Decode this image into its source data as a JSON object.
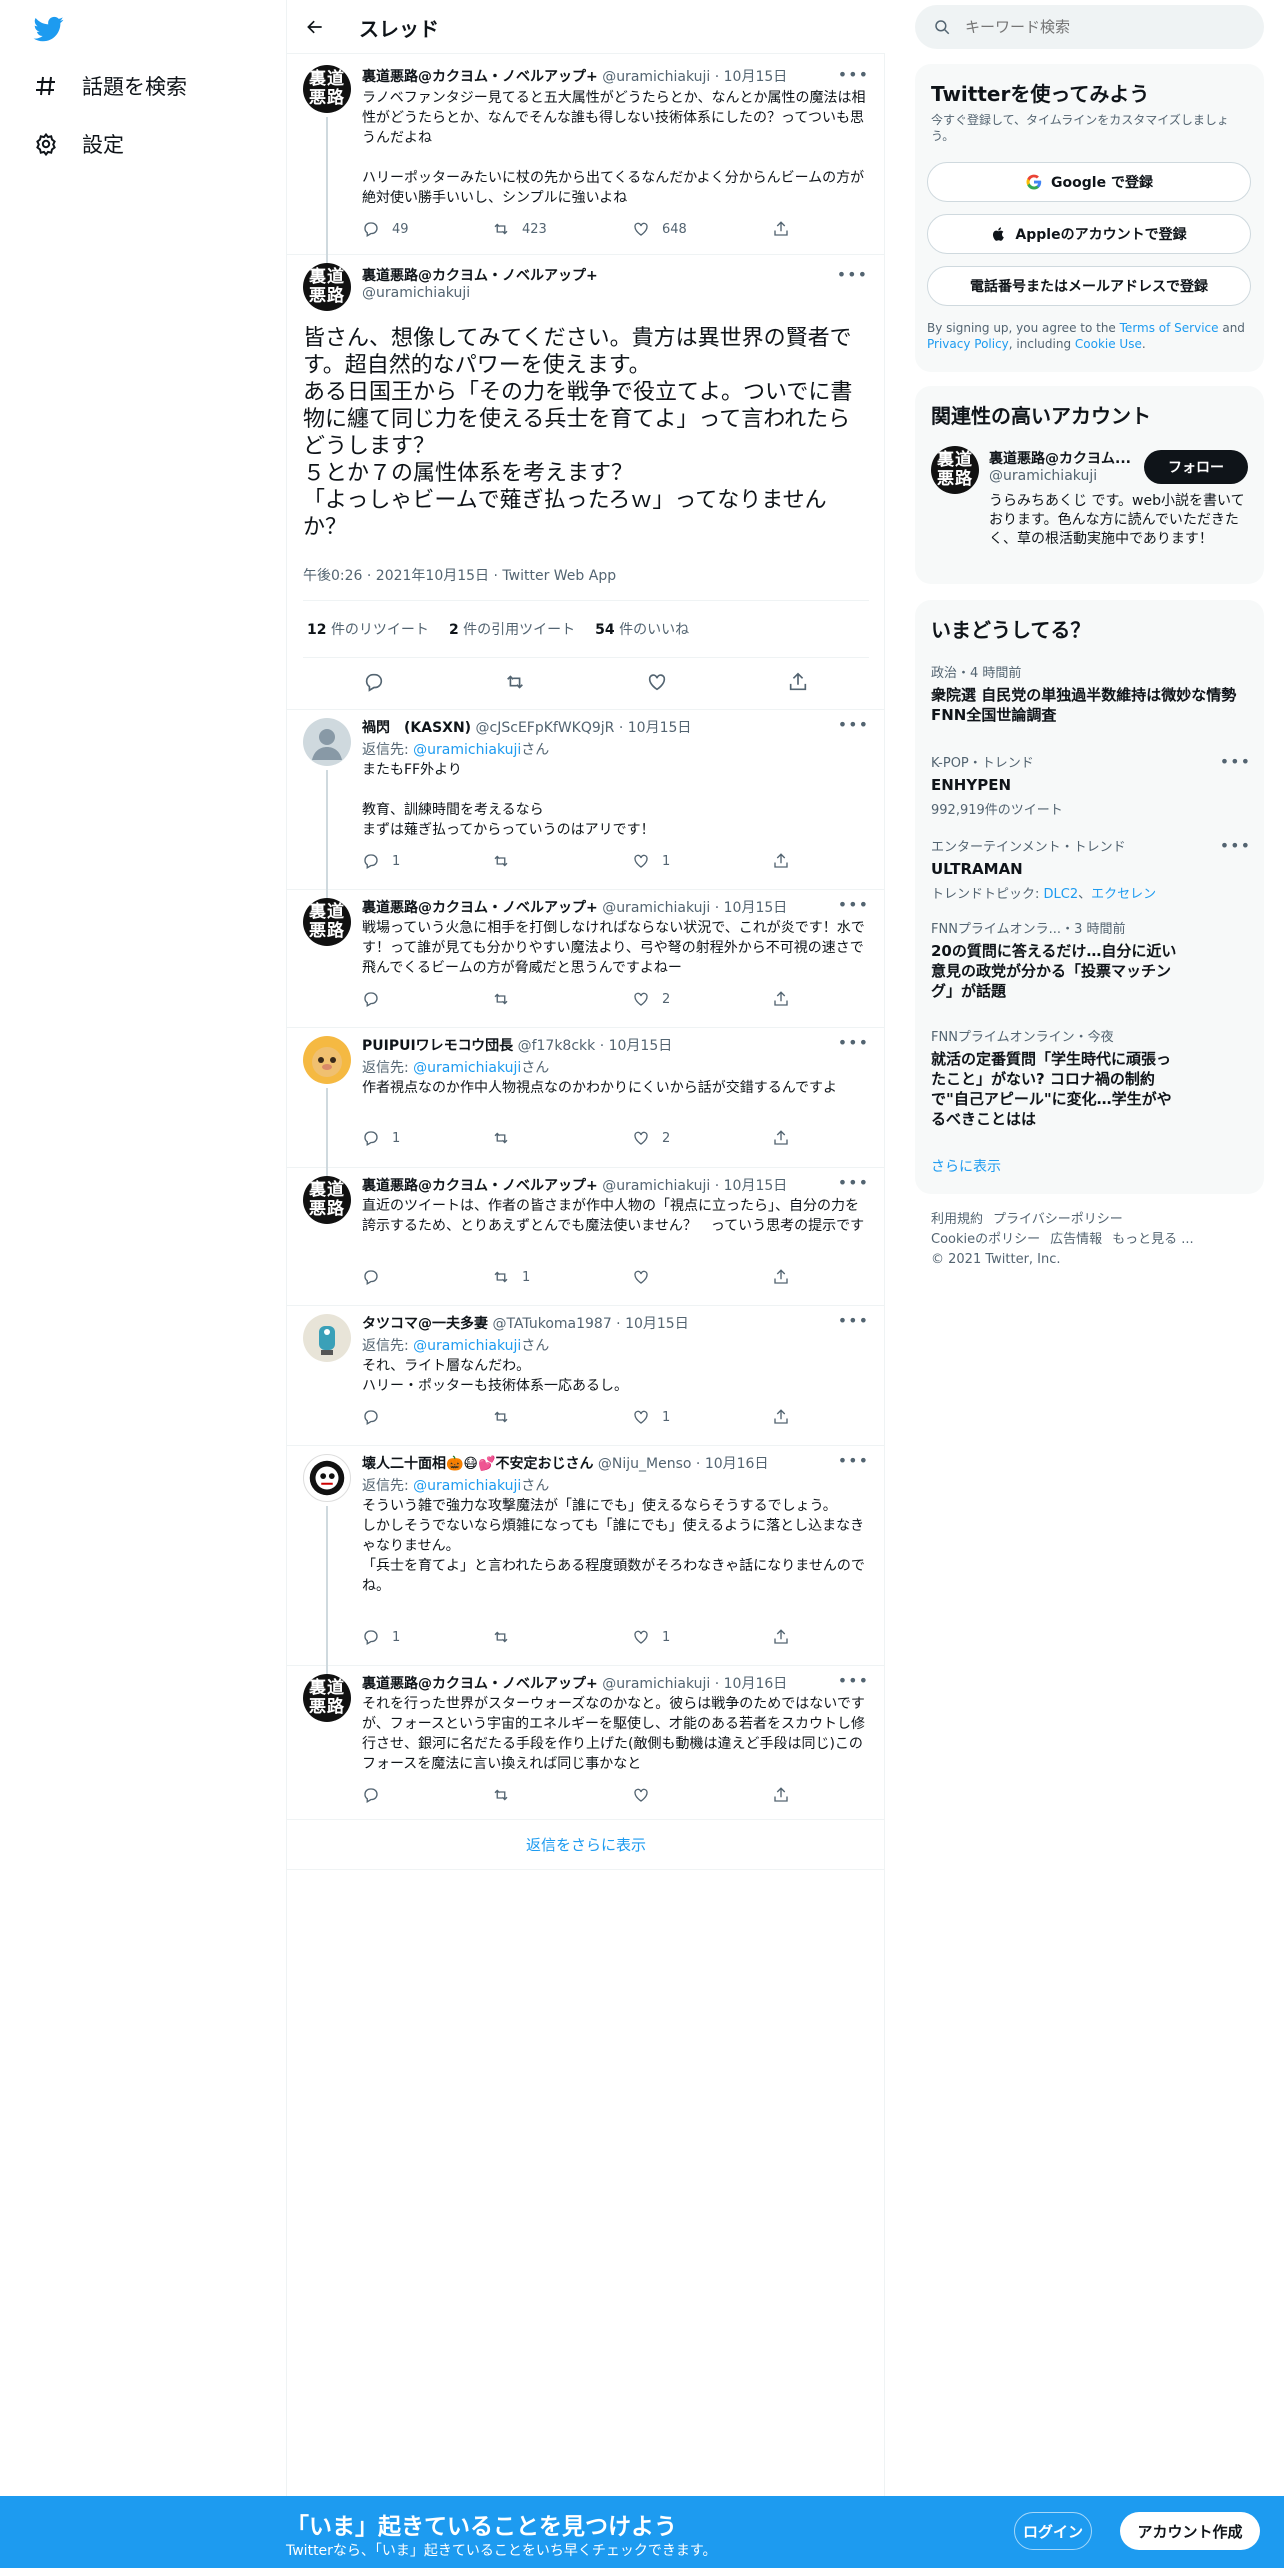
{
  "nav": {
    "explore": "話題を検索",
    "settings": "設定"
  },
  "header": {
    "title": "スレッド"
  },
  "tweets": {
    "t0": {
      "name": "裏道悪路@カクヨム・ノベルアップ+",
      "meta": "@uramichiakuji · 10月15日",
      "body": "ラノベファンタジー見てると五大属性がどうたらとか、なんとか属性の魔法は相性がどうたらとか、なんでそんな誰も得しない技術体系にしたの？ってついも思うんだよね\n\nハリーポッターみたいに杖の先から出てくるなんだかよく分からんビームの方が絶対使い勝手いいし、シンプルに強いよね",
      "replies": "49",
      "retweets": "423",
      "likes": "648"
    },
    "main": {
      "name": "裏道悪路@カクヨム・ノベルアップ+",
      "handle": "@uramichiakuji",
      "body": "皆さん、想像してみてください。貴方は異世界の賢者です。超自然的なパワーを使えます。\nある日国王から「その力を戦争で役立てよ。ついでに書物に纏て同じ力を使える兵士を育てよ」って言われたらどうします？\n５とか７の属性体系を考えます？\n「よっしゃビームで薙ぎ払ったろｗ」ってなりませんか？",
      "meta": "午後0:26 · 2021年10月15日 · Twitter Web App",
      "retweets_n": "12",
      "retweets_l": "件のリツイート",
      "quotes_n": "2",
      "quotes_l": "件の引用ツイート",
      "likes_n": "54",
      "likes_l": "件のいいね"
    },
    "r1": {
      "name": "禍閃　(KASXN)",
      "meta": "@cJScEFpKfWKQ9jR · 10月15日",
      "reply_to": "返信先: ",
      "reply_handle": "@uramichiakuji",
      "reply_suffix": "さん",
      "body": "またもFF外より\n\n教育、訓練時間を考えるなら\nまずは薙ぎ払ってからっていうのはアリです！",
      "replies": "1",
      "retweets": "",
      "likes": "1"
    },
    "r2": {
      "name": "裏道悪路@カクヨム・ノベルアップ+",
      "meta": "@uramichiakuji · 10月15日",
      "body": "戦場っていう火急に相手を打倒しなければならない状況で、これが炎です！水です！って誰が見ても分かりやすい魔法より、弓や弩の射程外から不可視の速さで飛んでくるビームの方が脅威だと思うんですよねー",
      "replies": "",
      "retweets": "",
      "likes": "2"
    },
    "r3": {
      "name": "PUIPUIワレモコウ団長",
      "meta": "@f17k8ckk · 10月15日",
      "reply_to": "返信先: ",
      "reply_handle": "@uramichiakuji",
      "reply_suffix": "さん",
      "body": "作者視点なのか作中人物視点なのかわかりにくいから話が交錯するんですよ",
      "replies": "1",
      "retweets": "",
      "likes": "2"
    },
    "r4": {
      "name": "裏道悪路@カクヨム・ノベルアップ+",
      "meta": "@uramichiakuji · 10月15日",
      "body": "直近のツイートは、作者の皆さまが作中人物の「視点に立ったら」、自分の力を誇示するため、とりあえずとんでも魔法使いません？　っていう思考の提示です",
      "replies": "",
      "retweets": "1",
      "likes": ""
    },
    "r5": {
      "name": "タツコマ@一夫多妻",
      "meta": "@TATukoma1987 · 10月15日",
      "reply_to": "返信先: ",
      "reply_handle": "@uramichiakuji",
      "reply_suffix": "さん",
      "body": "それ、ライト層なんだわ。\nハリー・ポッターも技術体系一応あるし。",
      "replies": "",
      "retweets": "",
      "likes": "1"
    },
    "r6": {
      "name": "壊人二十面相🎃😷💕不安定おじさん",
      "meta": "@Niju_Menso · 10月16日",
      "reply_to": "返信先: ",
      "reply_handle": "@uramichiakuji",
      "reply_suffix": "さん",
      "body": "そういう雑で強力な攻撃魔法が「誰にでも」使えるならそうするでしょう。\nしかしそうでないなら煩雑になっても「誰にでも」使えるように落とし込まなきゃなりません。\n「兵士を育てよ」と言われたらある程度頭数がそろわなきゃ話になりませんのでね。",
      "replies": "1",
      "retweets": "",
      "likes": "1"
    },
    "r7": {
      "name": "裏道悪路@カクヨム・ノベルアップ+",
      "meta": "@uramichiakuji · 10月16日",
      "body": "それを行った世界がスターウォーズなのかなと。彼らは戦争のためではないですが、フォースという宇宙的エネルギーを駆使し、才能のある若者をスカウトし修行させ、銀河に名だたる手段を作り上げた(敵側も動機は違えど手段は同じ)このフォースを魔法に言い換えれば同じ事かなと",
      "replies": "",
      "retweets": "",
      "likes": ""
    }
  },
  "show_more": "返信をさらに表示",
  "avatar_text": {
    "line1": "裏道",
    "line2": "悪路"
  },
  "search": {
    "placeholder": "キーワード検索"
  },
  "signup_card": {
    "title": "Twitterを使ってみよう",
    "subtitle": "今すぐ登録して、タイムラインをカスタマイズしましょう。",
    "google": "Google で登録",
    "apple": "Appleのアカウントで登録",
    "phone": "電話番号またはメールアドレスで登録",
    "terms_pre": "By signing up, you agree to the ",
    "terms": "Terms of Service",
    "terms_mid": " and ",
    "privacy": "Privacy Policy",
    "terms_mid2": ", including ",
    "cookie": "Cookie Use",
    "terms_end": "."
  },
  "related": {
    "title": "関連性の高いアカウント",
    "name": "裏道悪路@カクヨム...",
    "handle": "@uramichiakuji",
    "follow": "フォロー",
    "bio": "うらみちあくじ です。web小説を書いております。色んな方に読んでいただきたく、草の根活動実施中であります！"
  },
  "trends": {
    "title": "いまどうしてる？",
    "items": [
      {
        "cat": "政治・4 時間前",
        "title": "衆院選 自民党の単独過半数維持は微妙な情勢 FNN全国世論調査",
        "sub": ""
      },
      {
        "cat": "K-POP・トレンド",
        "title": "ENHYPEN",
        "sub": "992,919件のツイート"
      },
      {
        "cat": "エンターテインメント・トレンド",
        "title": "ULTRAMAN",
        "sub_pre": "トレンドトピック: ",
        "sub_a": "DLC2",
        "sub_mid": "、",
        "sub_b": "エクセレン"
      },
      {
        "cat": "FNNプライムオンラ...・3 時間前",
        "title": "20の質問に答えるだけ…自分に近い意見の政党が分かる「投票マッチング」が話題",
        "sub": ""
      },
      {
        "cat": "FNNプライムオンライン・今夜",
        "title": "就活の定番質問「学生時代に頑張ったこと」がない? コロナ禍の制約で\"自己アピール\"に変化…学生がやるべきことはは",
        "sub": ""
      }
    ],
    "more": "さらに表示"
  },
  "footer": {
    "links": [
      "利用規約",
      "プライバシーポリシー",
      "Cookieのポリシー",
      "広告情報",
      "もっと見る ..."
    ],
    "copyright": "© 2021 Twitter, Inc."
  },
  "bottom": {
    "title": "「いま」起きていることを見つけよう",
    "subtitle": "Twitterなら、「いま」起きていることをいち早くチェックできます。",
    "login": "ログイン",
    "signup": "アカウント作成"
  },
  "colors": {
    "accent": "#1d9bf0",
    "text": "#0f1419",
    "muted": "#536471"
  }
}
